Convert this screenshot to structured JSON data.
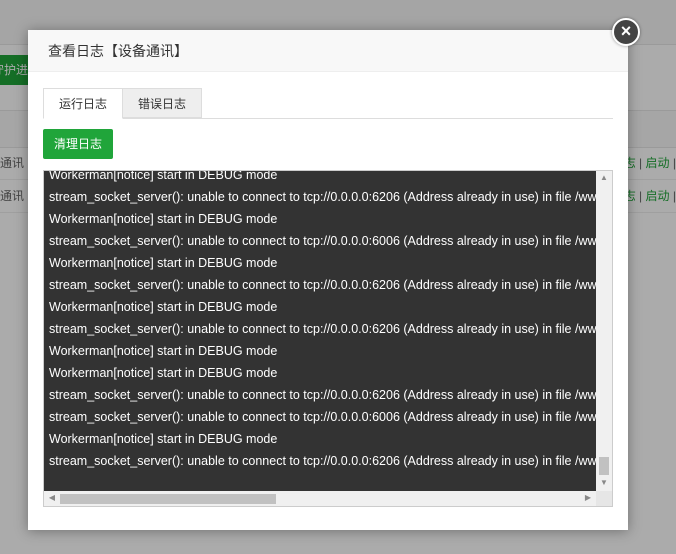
{
  "background": {
    "action_button_label": "守护进程",
    "rows": [
      {
        "name": "通讯",
        "ops": [
          "志",
          "启动",
          "|"
        ]
      },
      {
        "name": "通讯",
        "ops": [
          "志",
          "启动",
          "|"
        ]
      }
    ]
  },
  "dialog": {
    "title": "查看日志【设备通讯】",
    "close_glyph": "×",
    "tabs": [
      {
        "label": "运行日志",
        "active": true
      },
      {
        "label": "错误日志",
        "active": false
      }
    ],
    "clear_button_label": "清理日志",
    "log_lines": [
      "Workerman[notice] start in DEBUG mode",
      "stream_socket_server(): unable to connect to tcp://0.0.0.0:6206 (Address already in use) in file /www/wwwroot",
      "Workerman[notice] start in DEBUG mode",
      "stream_socket_server(): unable to connect to tcp://0.0.0.0:6006 (Address already in use) in file /www/wwwroot",
      "Workerman[notice] start in DEBUG mode",
      "stream_socket_server(): unable to connect to tcp://0.0.0.0:6206 (Address already in use) in file /www/wwwroot",
      "Workerman[notice] start in DEBUG mode",
      "stream_socket_server(): unable to connect to tcp://0.0.0.0:6206 (Address already in use) in file /www/wwwroot",
      "Workerman[notice] start in DEBUG mode",
      "Workerman[notice] start in DEBUG mode",
      "stream_socket_server(): unable to connect to tcp://0.0.0.0:6206 (Address already in use) in file /www/wwwroot",
      "stream_socket_server(): unable to connect to tcp://0.0.0.0:6006 (Address already in use) in file /www/wwwroot",
      "Workerman[notice] start in DEBUG mode",
      "stream_socket_server(): unable to connect to tcp://0.0.0.0:6206 (Address already in use) in file /www/wwwroot"
    ]
  },
  "colors": {
    "accent": "#20a53a",
    "log_bg": "#333333",
    "log_text": "#ffffff"
  }
}
